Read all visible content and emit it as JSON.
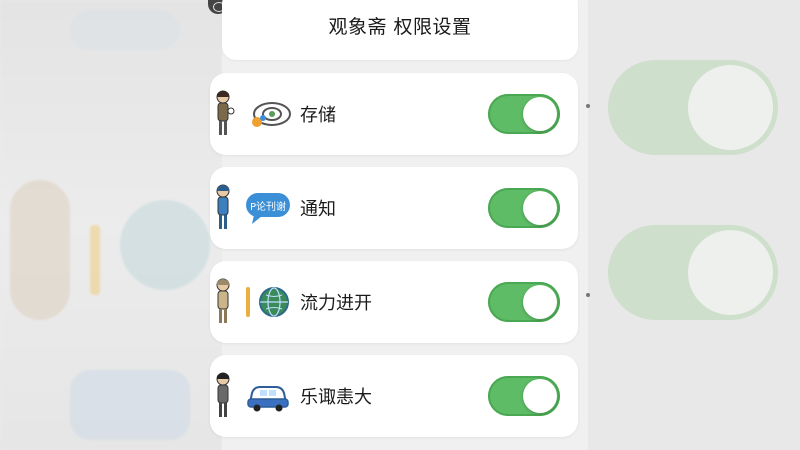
{
  "header": {
    "title": "观象斋 权限设置"
  },
  "permissions": [
    {
      "label": "存储",
      "icon": "storage-icon",
      "enabled": true
    },
    {
      "label": "通知",
      "icon": "notification-bubble-icon",
      "bubble_text": "P论刊谢",
      "enabled": true
    },
    {
      "label": "流力进开",
      "icon": "globe-icon",
      "enabled": true
    },
    {
      "label": "乐诹恚大",
      "icon": "car-icon",
      "enabled": true
    }
  ],
  "colors": {
    "toggle_on": "#5ebc66",
    "toggle_border": "#4aa852",
    "card": "#ffffff",
    "background": "#f0f0f0",
    "bubble": "#3b8fd6"
  }
}
